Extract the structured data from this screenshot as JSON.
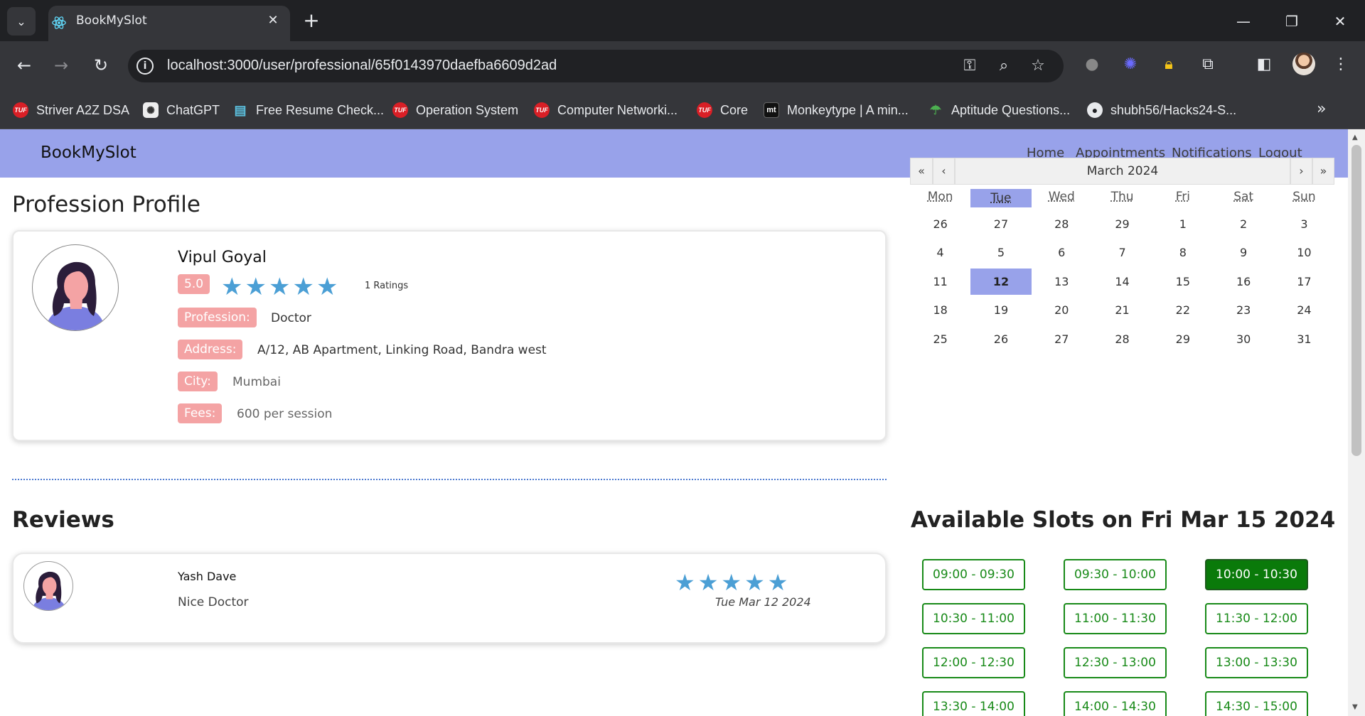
{
  "browser": {
    "tab_title": "BookMySlot",
    "url": "localhost:3000/user/professional/65f0143970daefba6609d2ad",
    "bookmarks": [
      {
        "label": "Striver A2Z DSA",
        "icon": "tuf-icon"
      },
      {
        "label": "ChatGPT",
        "icon": "chatgpt-icon"
      },
      {
        "label": "Free Resume Check...",
        "icon": "document-icon"
      },
      {
        "label": "Operation System",
        "icon": "tuf-icon"
      },
      {
        "label": "Computer Networki...",
        "icon": "tuf-icon"
      },
      {
        "label": "Core",
        "icon": "tuf-icon"
      },
      {
        "label": "Monkeytype | A min...",
        "icon": "monkeytype-icon"
      },
      {
        "label": "Aptitude Questions...",
        "icon": "aptitude-icon"
      },
      {
        "label": "shubh56/Hacks24-S...",
        "icon": "github-icon"
      }
    ],
    "tuf_icon_text": "TUF",
    "mt_icon_text": "mt"
  },
  "nav": {
    "brand": "BookMySlot",
    "links": [
      "Home",
      "Appointments",
      "Notifications",
      "Logout"
    ]
  },
  "profile": {
    "heading": "Profession Profile",
    "name": "Vipul Goyal",
    "rating": "5.0",
    "stars": 5,
    "ratings_count": "1 Ratings",
    "fields": [
      {
        "label": "Profession:",
        "value": "Doctor"
      },
      {
        "label": "Address:",
        "value": "A/12, AB Apartment, Linking Road, Bandra west"
      },
      {
        "label": "City:",
        "value": "Mumbai"
      },
      {
        "label": "Fees:",
        "value": "600 per session"
      }
    ]
  },
  "reviews": {
    "heading": "Reviews",
    "items": [
      {
        "name": "Yash Dave",
        "text": "Nice Doctor",
        "stars": 5,
        "date": "Tue Mar 12 2024"
      }
    ]
  },
  "calendar": {
    "prev_year": "«",
    "prev_month": "‹",
    "next_month": "›",
    "next_year": "»",
    "month_label": "March 2024",
    "weekdays": [
      "Mon",
      "Tue",
      "Wed",
      "Thu",
      "Fri",
      "Sat",
      "Sun"
    ],
    "today_weekday_index": 1,
    "weeks": [
      [
        "26",
        "27",
        "28",
        "29",
        "1",
        "2",
        "3"
      ],
      [
        "4",
        "5",
        "6",
        "7",
        "8",
        "9",
        "10"
      ],
      [
        "11",
        "12",
        "13",
        "14",
        "15",
        "16",
        "17"
      ],
      [
        "18",
        "19",
        "20",
        "21",
        "22",
        "23",
        "24"
      ],
      [
        "25",
        "26",
        "27",
        "28",
        "29",
        "30",
        "31"
      ]
    ],
    "today": "12",
    "highlight_color": "#98a2ea"
  },
  "slots": {
    "heading": "Available Slots on Fri Mar 15 2024",
    "items": [
      "09:00 - 09:30",
      "09:30 - 10:00",
      "10:00 - 10:30",
      "10:30 - 11:00",
      "11:00 - 11:30",
      "11:30 - 12:00",
      "12:00 - 12:30",
      "12:30 - 13:00",
      "13:00 - 13:30",
      "13:30 - 14:00",
      "14:00 - 14:30",
      "14:30 - 15:00"
    ],
    "selected": "10:00 - 10:30",
    "accent_color": "#188a18"
  },
  "colors": {
    "navbar": "#98a2ea",
    "badge": "#f4a3a4",
    "star": "#4b9fd5"
  }
}
